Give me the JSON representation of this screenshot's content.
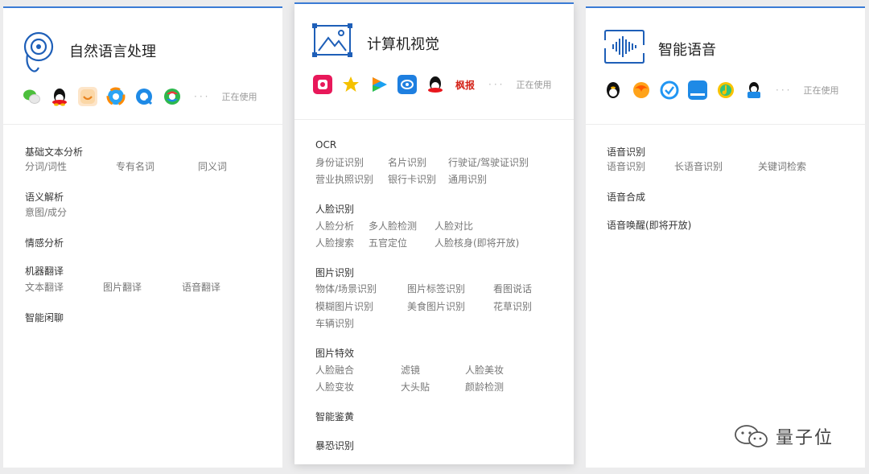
{
  "cards": {
    "nlp": {
      "title": "自然语言处理",
      "using": "正在使用",
      "apps": [
        "wechat",
        "qq",
        "jd",
        "tencent-video",
        "qq-browser",
        "tencent-cloud"
      ],
      "sections": [
        {
          "title": "基础文本分析",
          "items": [
            "分词/词性",
            "专有名词",
            "同义词"
          ]
        },
        {
          "title": "语义解析",
          "items": [
            "意图/成分"
          ]
        },
        {
          "title": "情感分析",
          "items": []
        },
        {
          "title": "机器翻译",
          "items": [
            "文本翻译",
            "图片翻译",
            "语音翻译"
          ]
        },
        {
          "title": "智能闲聊",
          "items": []
        }
      ]
    },
    "cv": {
      "title": "计算机视觉",
      "using": "正在使用",
      "apps": [
        "tiantian-p-tu",
        "qzone",
        "tencent-video",
        "weiyun",
        "qq",
        "fanbao"
      ],
      "app_labels": {
        "fanbao": "枫报"
      },
      "sections": [
        {
          "title": "OCR",
          "items": [
            "身份证识别",
            "名片识别",
            "行驶证/驾驶证识别",
            "营业执照识别",
            "银行卡识别",
            "通用识别"
          ]
        },
        {
          "title": "人脸识别",
          "items": [
            "人脸分析",
            "多人脸检测",
            "人脸对比",
            "人脸搜索",
            "五官定位",
            "人脸核身(即将开放)"
          ]
        },
        {
          "title": "图片识别",
          "items": [
            "物体/场景识别",
            "图片标签识别",
            "看图说话",
            "模糊图片识别",
            "美食图片识别",
            "花草识别",
            "车辆识别"
          ]
        },
        {
          "title": "图片特效",
          "items": [
            "人脸融合",
            "滤镜",
            "人脸美妆",
            "人脸变妆",
            "大头贴",
            "颜龄检测"
          ]
        },
        {
          "title": "智能鉴黄",
          "items": []
        },
        {
          "title": "暴恐识别",
          "items": []
        }
      ]
    },
    "sp": {
      "title": "智能语音",
      "using": "正在使用",
      "apps": [
        "qq-penguin",
        "tencent-game",
        "qq-call",
        "tencent-doc",
        "qq-music",
        "qq-reader"
      ],
      "sections": [
        {
          "title": "语音识别",
          "items": [
            "语音识别",
            "长语音识别",
            "关键词检索"
          ]
        },
        {
          "title": "语音合成",
          "items": []
        },
        {
          "title": "语音唤醒(即将开放)",
          "items": []
        }
      ]
    }
  },
  "watermark": "量子位",
  "colors": {
    "accent": "#3a7bd5",
    "bg": "#ececed"
  }
}
